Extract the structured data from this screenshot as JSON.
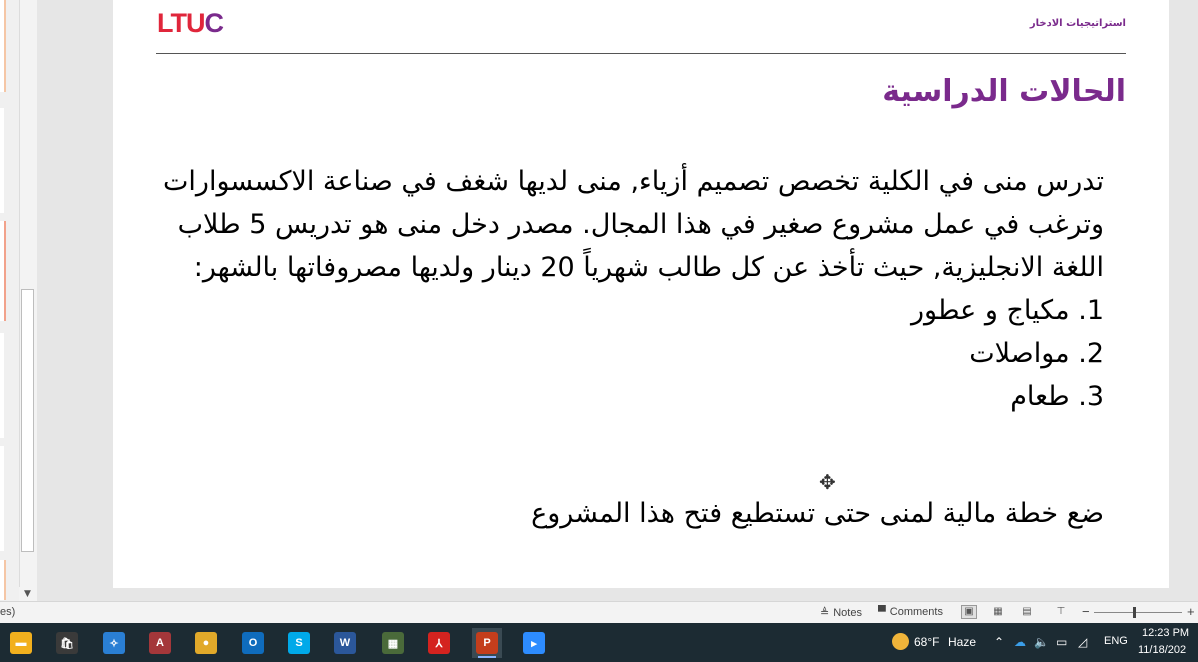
{
  "slide": {
    "logo_main": "LTU",
    "logo_accent": "C",
    "header_title": "استراتيجيات الادخار",
    "title": "الحالات الدراسية",
    "paragraph": "تدرس منى في الكلية تخصص تصميم أزياء, منى لديها شغف في صناعة الاكسسوارات وترغب في عمل مشروع صغير في هذا المجال. مصدر دخل منى هو تدريس 5 طلاب اللغة الانجليزية, حيث تأخذ عن كل طالب شهرياً 20 دينار ولديها مصروفاتها بالشهر:",
    "expenses": [
      "1. مكياج و عطور",
      "2. مواصلات",
      "3. طعام"
    ],
    "task": "ضع خطة مالية لمنى حتى تستطيع فتح هذا المشروع"
  },
  "statusbar": {
    "left_fragment": "es)",
    "notes_label": "Notes",
    "comments_label": "Comments",
    "zoom_minus": "−",
    "zoom_plus": "+"
  },
  "taskbar": {
    "apps": [
      {
        "name": "file-explorer-icon",
        "color": "#f2b01e",
        "glyph": "▬"
      },
      {
        "name": "store-icon",
        "color": "#3a3a3a",
        "glyph": "🛍"
      },
      {
        "name": "teams-like-icon",
        "color": "#2a7fd4",
        "glyph": "✧"
      },
      {
        "name": "access-icon",
        "color": "#a4373a",
        "glyph": "A"
      },
      {
        "name": "chrome-icon",
        "color": "#e1a92a",
        "glyph": "●"
      },
      {
        "name": "outlook-icon",
        "color": "#0f6cbd",
        "glyph": "O"
      },
      {
        "name": "skype-icon",
        "color": "#00a9e9",
        "glyph": "S"
      },
      {
        "name": "word-icon",
        "color": "#2b579a",
        "glyph": "W"
      },
      {
        "name": "media-icon",
        "color": "#4a6a3a",
        "glyph": "▦"
      },
      {
        "name": "acrobat-icon",
        "color": "#d4231f",
        "glyph": "⅄"
      },
      {
        "name": "powerpoint-icon",
        "color": "#c43e1c",
        "glyph": "P"
      },
      {
        "name": "zoom-icon",
        "color": "#2d8cff",
        "glyph": "▸"
      }
    ],
    "weather_temp": "68°F",
    "weather_desc": "Haze",
    "language": "ENG",
    "time": "12:23 PM",
    "date": "11/18/202"
  }
}
